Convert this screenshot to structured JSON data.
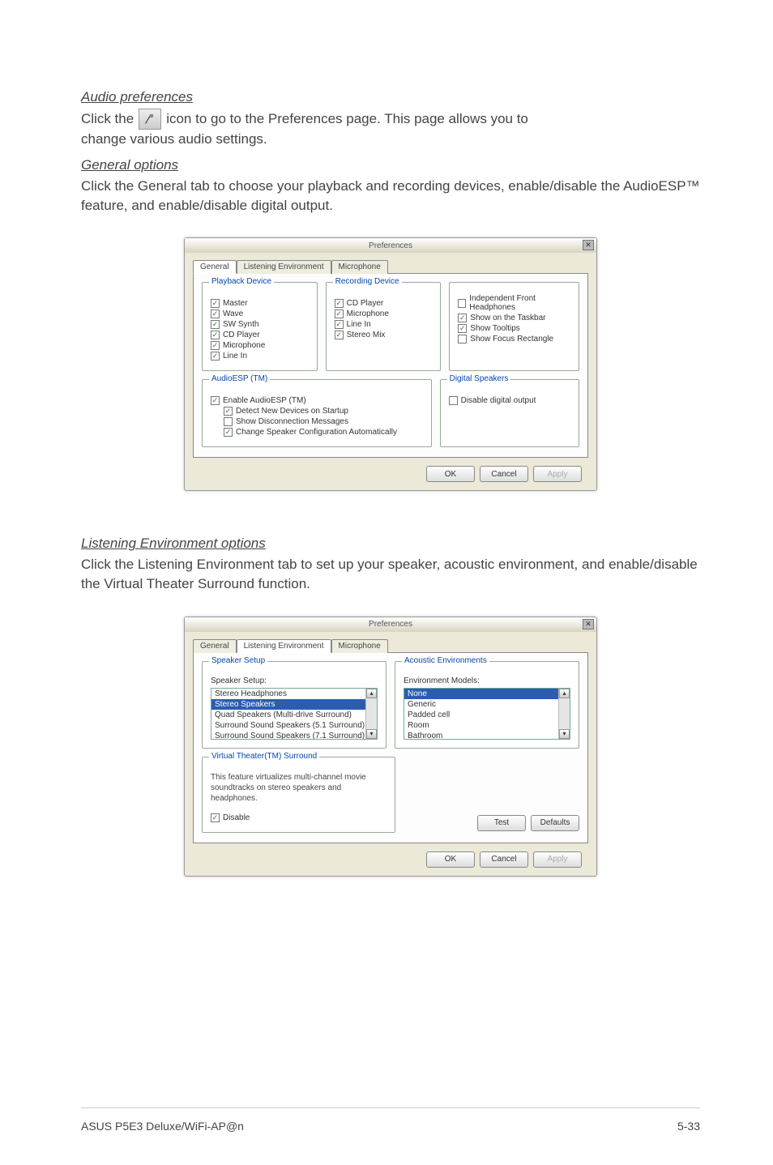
{
  "sections": {
    "audio_prefs_heading": "Audio preferences",
    "audio_prefs_line1a": "Click the",
    "audio_prefs_line1b": "icon to go to the Preferences page. This page allows you to",
    "audio_prefs_line2": "change various audio settings.",
    "general_heading": "General options",
    "general_body": "Click the General tab to choose your playback and recording devices, enable/disable the AudioESP™ feature, and enable/disable digital output.",
    "listening_heading": "Listening Environment options",
    "listening_body": "Click the Listening Environment tab to set up your speaker, acoustic environment, and enable/disable the Virtual Theater Surround function."
  },
  "dialog1": {
    "title": "Preferences",
    "tabs": [
      "General",
      "Listening Environment",
      "Microphone"
    ],
    "active_tab": 0,
    "playback": {
      "legend": "Playback Device",
      "items": [
        {
          "label": "Master",
          "checked": true
        },
        {
          "label": "Wave",
          "checked": true
        },
        {
          "label": "SW Synth",
          "checked": true
        },
        {
          "label": "CD Player",
          "checked": true
        },
        {
          "label": "Microphone",
          "checked": true
        },
        {
          "label": "Line In",
          "checked": true
        }
      ]
    },
    "recording": {
      "legend": "Recording Device",
      "items": [
        {
          "label": "CD Player",
          "checked": true
        },
        {
          "label": "Microphone",
          "checked": true
        },
        {
          "label": "Line In",
          "checked": true
        },
        {
          "label": "Stereo Mix",
          "checked": true
        }
      ]
    },
    "right_opts": [
      {
        "label": "Independent Front Headphones",
        "checked": false
      },
      {
        "label": "Show on the Taskbar",
        "checked": true
      },
      {
        "label": "Show Tooltips",
        "checked": true
      },
      {
        "label": "Show Focus Rectangle",
        "checked": false
      }
    ],
    "audioesp": {
      "legend": "AudioESP (TM)",
      "items": [
        {
          "label": "Enable AudioESP (TM)",
          "checked": true
        },
        {
          "label": "Detect New Devices on Startup",
          "checked": true
        },
        {
          "label": "Show Disconnection Messages",
          "checked": false
        },
        {
          "label": "Change Speaker Configuration Automatically",
          "checked": true
        }
      ]
    },
    "digital": {
      "legend": "Digital Speakers",
      "items": [
        {
          "label": "Disable digital output",
          "checked": false
        }
      ]
    },
    "buttons": {
      "ok": "OK",
      "cancel": "Cancel",
      "apply": "Apply"
    }
  },
  "dialog2": {
    "title": "Preferences",
    "tabs": [
      "General",
      "Listening Environment",
      "Microphone"
    ],
    "active_tab": 1,
    "speaker_setup": {
      "legend": "Speaker Setup",
      "label": "Speaker Setup:",
      "options": [
        "Stereo Headphones",
        "Stereo Speakers",
        "Quad Speakers (Multi-drive Surround)",
        "Surround Sound Speakers (5.1 Surround)",
        "Surround Sound Speakers (7.1 Surround)"
      ],
      "selected_index": 1
    },
    "acoustic_env": {
      "legend": "Acoustic Environments",
      "label": "Environment Models:",
      "options": [
        "None",
        "Generic",
        "Padded cell",
        "Room",
        "Bathroom"
      ],
      "selected_index": 0
    },
    "virtual_theater": {
      "legend": "Virtual Theater(TM) Surround",
      "desc": "This feature virtualizes multi-channel movie soundtracks on stereo speakers and headphones.",
      "disable": {
        "label": "Disable",
        "checked": true
      }
    },
    "buttons": {
      "test": "Test",
      "defaults": "Defaults",
      "ok": "OK",
      "cancel": "Cancel",
      "apply": "Apply"
    }
  },
  "footer": {
    "left": "ASUS P5E3 Deluxe/WiFi-AP@n",
    "right": "5-33"
  }
}
